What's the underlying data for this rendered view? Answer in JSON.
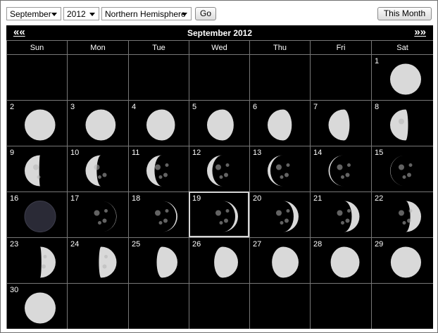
{
  "toolbar": {
    "month": "September",
    "year": "2012",
    "hemisphere": "Northern Hemisphere",
    "go_label": "Go",
    "this_month_label": "This Month"
  },
  "calendar": {
    "title": "September 2012",
    "prev_label": "««",
    "next_label": "»»",
    "weekdays": [
      "Sun",
      "Mon",
      "Tue",
      "Wed",
      "Thu",
      "Fri",
      "Sat"
    ],
    "first_weekday_index": 6,
    "days_in_month": 30,
    "today": 19,
    "illumination": {
      "1": 1.0,
      "2": 0.99,
      "3": 0.97,
      "4": 0.92,
      "5": 0.86,
      "6": 0.78,
      "7": 0.68,
      "8": 0.58,
      "9": 0.47,
      "10": 0.36,
      "11": 0.26,
      "12": 0.17,
      "13": 0.09,
      "14": 0.04,
      "15": 0.01,
      "16": 0.0,
      "17": 0.01,
      "18": 0.04,
      "19": 0.09,
      "20": 0.16,
      "21": 0.25,
      "22": 0.35,
      "23": 0.46,
      "24": 0.57,
      "25": 0.67,
      "26": 0.77,
      "27": 0.86,
      "28": 0.93,
      "29": 0.98,
      "30": 1.0
    },
    "waxing_from_day": 17,
    "colors": {
      "background": "#000000",
      "moon_light": "#d9d9d9",
      "moon_dark": "#2a2a36",
      "grid": "#777777"
    }
  }
}
